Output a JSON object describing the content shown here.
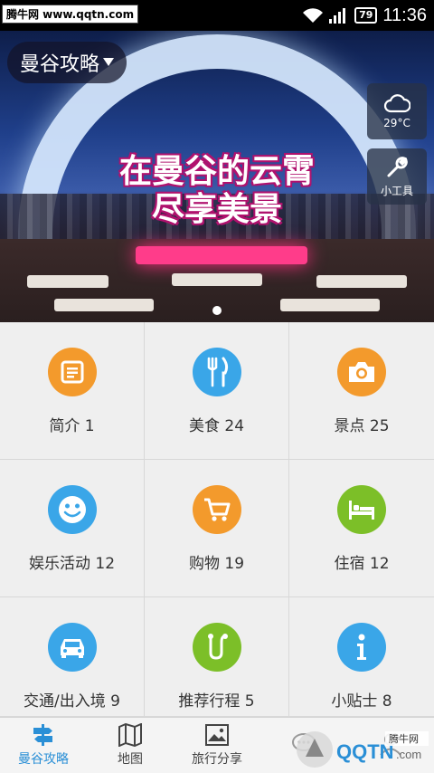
{
  "status_bar": {
    "watermark": "腾牛网 www.qqtn.com",
    "battery": "79",
    "time": "11:36"
  },
  "hero": {
    "city_selector": "曼谷攻略",
    "weather_temp": "29°C",
    "tools_label": "小工具",
    "title_line1": "在曼谷的云霄",
    "title_line2": "尽享美景"
  },
  "grid": [
    {
      "label": "简介 1",
      "color": "#f39a2c",
      "icon": "document-icon"
    },
    {
      "label": "美食 24",
      "color": "#3aa6e8",
      "icon": "fork-knife-icon"
    },
    {
      "label": "景点 25",
      "color": "#f39a2c",
      "icon": "camera-icon"
    },
    {
      "label": "娱乐活动 12",
      "color": "#3aa6e8",
      "icon": "smile-icon"
    },
    {
      "label": "购物 19",
      "color": "#f39a2c",
      "icon": "cart-icon"
    },
    {
      "label": "住宿 12",
      "color": "#7cbf28",
      "icon": "bed-icon"
    },
    {
      "label": "交通/出入境 9",
      "color": "#3aa6e8",
      "icon": "car-icon"
    },
    {
      "label": "推荐行程 5",
      "color": "#7cbf28",
      "icon": "route-icon"
    },
    {
      "label": "小贴士 8",
      "color": "#3aa6e8",
      "icon": "info-icon"
    }
  ],
  "bottom_nav": [
    {
      "label": "曼谷攻略",
      "icon": "signpost-icon",
      "active": true
    },
    {
      "label": "地图",
      "icon": "map-icon",
      "active": false
    },
    {
      "label": "旅行分享",
      "icon": "picture-icon",
      "active": false
    },
    {
      "label": "",
      "icon": "chat-icon",
      "active": false
    },
    {
      "label": "",
      "icon": "person-icon",
      "active": false
    }
  ],
  "watermark_bottom": "腾牛网 QQTN.com",
  "colors": {
    "accent": "#2a8fd6",
    "orange": "#f39a2c",
    "blue": "#3aa6e8",
    "green": "#7cbf28"
  }
}
